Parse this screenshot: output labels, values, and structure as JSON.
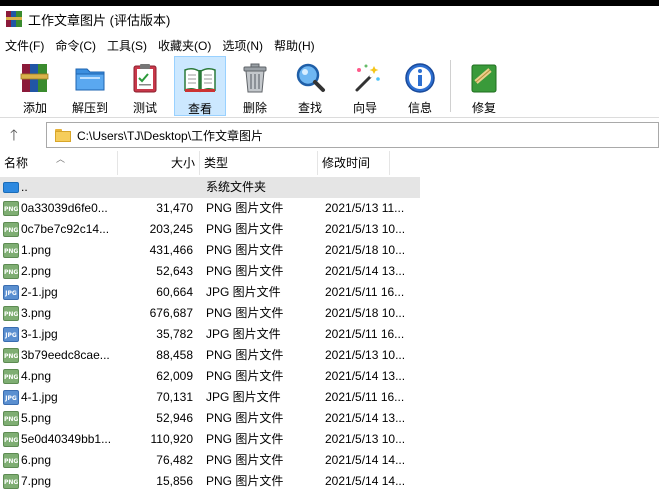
{
  "window": {
    "title": "工作文章图片 (评估版本)"
  },
  "menu": [
    "文件(F)",
    "命令(C)",
    "工具(S)",
    "收藏夹(O)",
    "选项(N)",
    "帮助(H)"
  ],
  "toolbar": {
    "add": "添加",
    "extract": "解压到",
    "test": "测试",
    "view": "查看",
    "delete": "删除",
    "find": "查找",
    "wizard": "向导",
    "info": "信息",
    "repair": "修复"
  },
  "address": {
    "path": "C:\\Users\\TJ\\Desktop\\工作文章图片"
  },
  "columns": {
    "name": "名称",
    "size": "大小",
    "type": "类型",
    "modified": "修改时间"
  },
  "files": [
    {
      "name": "..",
      "size": "",
      "type": "系统文件夹",
      "modified": "",
      "icon": "folder"
    },
    {
      "name": "0a33039d6fe0...",
      "size": "31,470",
      "type": "PNG 图片文件",
      "modified": "2021/5/13 11...",
      "icon": "png"
    },
    {
      "name": "0c7be7c92c14...",
      "size": "203,245",
      "type": "PNG 图片文件",
      "modified": "2021/5/13 10...",
      "icon": "png"
    },
    {
      "name": "1.png",
      "size": "431,466",
      "type": "PNG 图片文件",
      "modified": "2021/5/18 10...",
      "icon": "png"
    },
    {
      "name": "2.png",
      "size": "52,643",
      "type": "PNG 图片文件",
      "modified": "2021/5/14 13...",
      "icon": "png"
    },
    {
      "name": "2-1.jpg",
      "size": "60,664",
      "type": "JPG 图片文件",
      "modified": "2021/5/11 16...",
      "icon": "jpg"
    },
    {
      "name": "3.png",
      "size": "676,687",
      "type": "PNG 图片文件",
      "modified": "2021/5/18 10...",
      "icon": "png"
    },
    {
      "name": "3-1.jpg",
      "size": "35,782",
      "type": "JPG 图片文件",
      "modified": "2021/5/11 16...",
      "icon": "jpg"
    },
    {
      "name": "3b79eedc8cae...",
      "size": "88,458",
      "type": "PNG 图片文件",
      "modified": "2021/5/13 10...",
      "icon": "png"
    },
    {
      "name": "4.png",
      "size": "62,009",
      "type": "PNG 图片文件",
      "modified": "2021/5/14 13...",
      "icon": "png"
    },
    {
      "name": "4-1.jpg",
      "size": "70,131",
      "type": "JPG 图片文件",
      "modified": "2021/5/11 16...",
      "icon": "jpg"
    },
    {
      "name": "5.png",
      "size": "52,946",
      "type": "PNG 图片文件",
      "modified": "2021/5/14 13...",
      "icon": "png"
    },
    {
      "name": "5e0d40349bb1...",
      "size": "110,920",
      "type": "PNG 图片文件",
      "modified": "2021/5/13 10...",
      "icon": "png"
    },
    {
      "name": "6.png",
      "size": "76,482",
      "type": "PNG 图片文件",
      "modified": "2021/5/14 14...",
      "icon": "png"
    },
    {
      "name": "7.png",
      "size": "15,856",
      "type": "PNG 图片文件",
      "modified": "2021/5/14 14...",
      "icon": "png"
    }
  ],
  "colors": {
    "selected_tool": "#cce8ff",
    "selected_row": "#e5e5e5"
  }
}
